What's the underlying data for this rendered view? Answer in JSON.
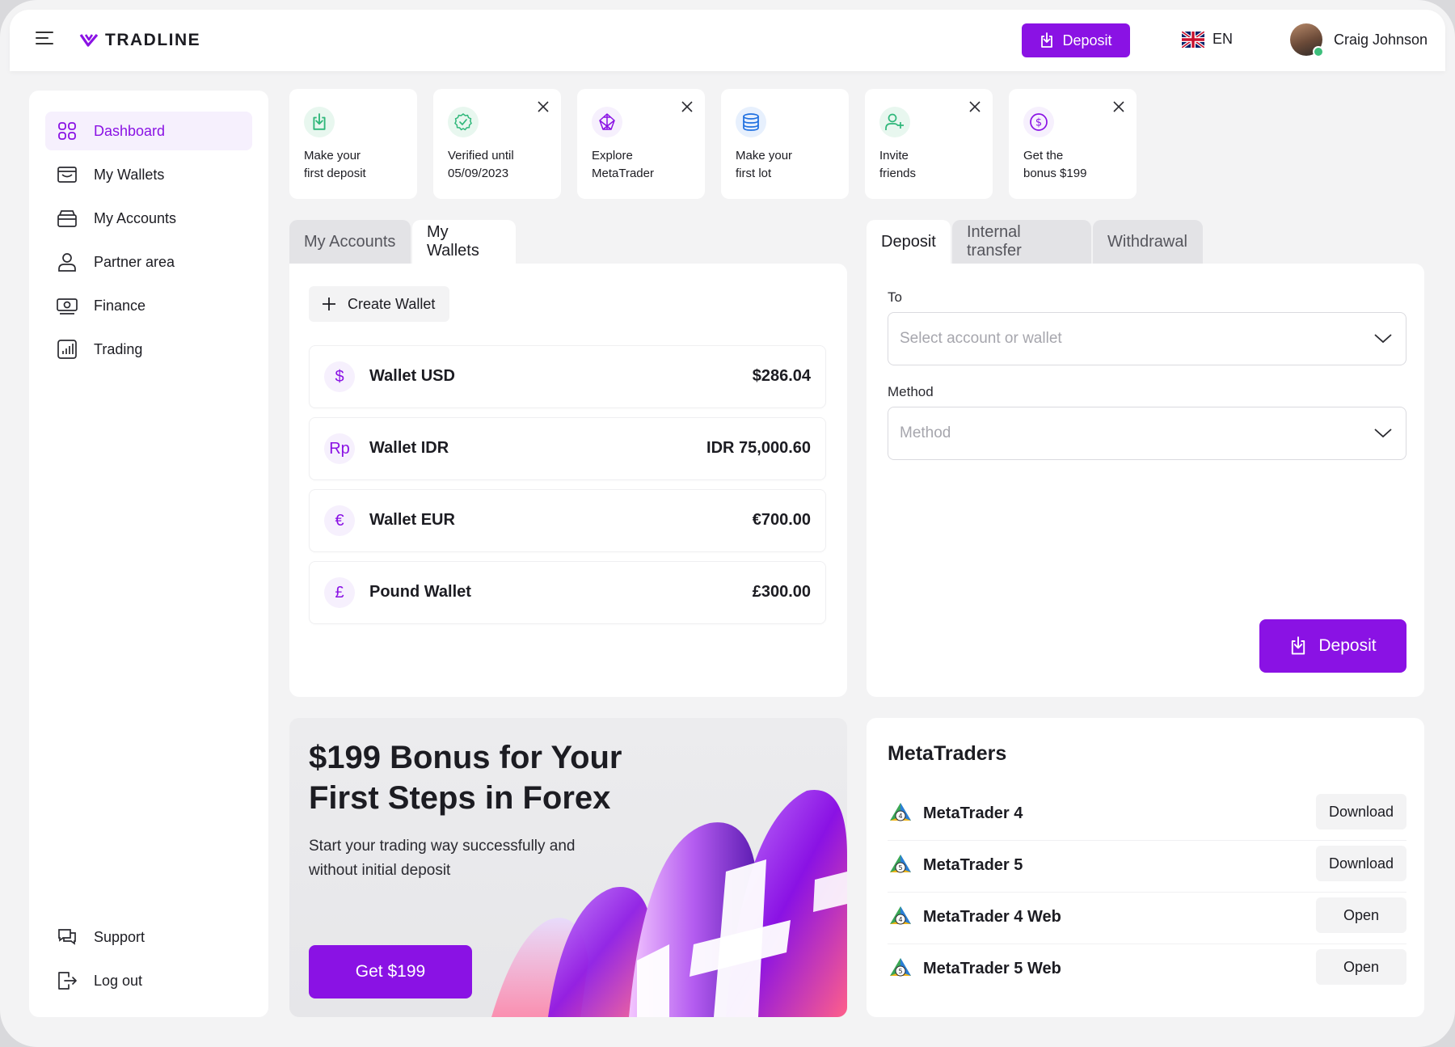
{
  "brand": {
    "name": "TRADLINE",
    "accent": "#8a12e4"
  },
  "header": {
    "deposit_label": "Deposit",
    "language": "EN",
    "user_name": "Craig Johnson"
  },
  "sidebar": {
    "items": [
      {
        "label": "Dashboard",
        "icon": "grid-icon",
        "active": true
      },
      {
        "label": "My Wallets",
        "icon": "wallet-icon"
      },
      {
        "label": "My Accounts",
        "icon": "card-stack-icon"
      },
      {
        "label": "Partner area",
        "icon": "user-icon"
      },
      {
        "label": "Finance",
        "icon": "money-icon"
      },
      {
        "label": "Trading",
        "icon": "chart-icon"
      }
    ],
    "footer": [
      {
        "label": "Support",
        "icon": "chat-icon"
      },
      {
        "label": "Log out",
        "icon": "logout-icon"
      }
    ]
  },
  "quick_actions": [
    {
      "line1": "Make your",
      "line2": "first deposit",
      "icon": "deposit-icon",
      "color": "#2fb77a",
      "closable": false
    },
    {
      "line1": "Verified until",
      "line2": "05/09/2023",
      "icon": "check-circle-icon",
      "color": "#2fb77a",
      "closable": true
    },
    {
      "line1": "Explore",
      "line2": "MetaTrader",
      "icon": "metatrader-icon",
      "color": "#8a12e4",
      "closable": true
    },
    {
      "line1": "Make your",
      "line2": "first lot",
      "icon": "coins-stack-icon",
      "color": "#1e6fe0",
      "closable": false
    },
    {
      "line1": "Invite",
      "line2": "friends",
      "icon": "add-user-icon",
      "color": "#2fb77a",
      "closable": true
    },
    {
      "line1": "Get the",
      "line2": "bonus $199",
      "icon": "dollar-coin-icon",
      "color": "#8a12e4",
      "closable": true
    }
  ],
  "accounts_tabs": {
    "tab1": "My Accounts",
    "tab2": "My Wallets",
    "active": "My Wallets"
  },
  "wallets": {
    "create_label": "Create Wallet",
    "rows": [
      {
        "symbol": "$",
        "name": "Wallet USD",
        "amount": "$286.04"
      },
      {
        "symbol": "Rp",
        "name": "Wallet IDR",
        "amount": "IDR 75,000.60"
      },
      {
        "symbol": "€",
        "name": "Wallet EUR",
        "amount": "€700.00"
      },
      {
        "symbol": "£",
        "name": "Pound Wallet",
        "amount": "£300.00"
      }
    ]
  },
  "transfer_tabs": {
    "tab1": "Deposit",
    "tab2": "Internal transfer",
    "tab3": "Withdrawal",
    "active": "Deposit"
  },
  "deposit_form": {
    "to_label": "To",
    "to_placeholder": "Select account or wallet",
    "method_label": "Method",
    "method_placeholder": "Method",
    "submit_label": "Deposit"
  },
  "promo": {
    "title_line1": "$199 Bonus for Your",
    "title_line2": "First Steps in Forex",
    "subtitle_line1": "Start your trading way successfully and",
    "subtitle_line2": "without initial deposit",
    "button_label": "Get $199"
  },
  "metatraders": {
    "title": "MetaTraders",
    "rows": [
      {
        "name": "MetaTrader 4",
        "badge": "4",
        "action": "Download"
      },
      {
        "name": "MetaTrader 5",
        "badge": "5",
        "action": "Download"
      },
      {
        "name": "MetaTrader 4 Web",
        "badge": "4",
        "action": "Open"
      },
      {
        "name": "MetaTrader 5 Web",
        "badge": "5",
        "action": "Open"
      }
    ]
  }
}
